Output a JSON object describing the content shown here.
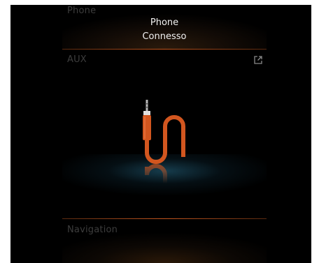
{
  "phone": {
    "section_label": "Phone",
    "title": "Phone",
    "status": "Connesso"
  },
  "aux": {
    "section_label": "AUX",
    "icons": [
      "external-link-icon",
      "aux-cable-icon"
    ]
  },
  "navigation": {
    "section_label": "Navigation"
  },
  "colors": {
    "accent": "#d2561f",
    "divider": "#c4551d",
    "label": "#3d3d3d",
    "text": "#f2f2f2",
    "glow": "#2a7090"
  }
}
